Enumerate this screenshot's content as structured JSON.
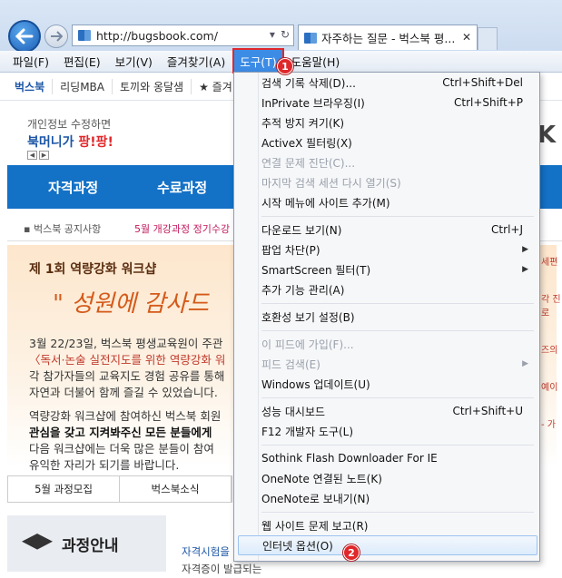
{
  "browser": {
    "url": "http://bugsbook.com/",
    "tab_title": "자주하는 질문 - 벅스북 평..."
  },
  "menubar": {
    "items": [
      {
        "label": "파일(F)"
      },
      {
        "label": "편집(E)"
      },
      {
        "label": "보기(V)"
      },
      {
        "label": "즐겨찾기(A)"
      },
      {
        "label": "도구(T)"
      },
      {
        "label": "도움말(H)"
      }
    ]
  },
  "favorites": {
    "items": [
      {
        "label": "벅스북"
      },
      {
        "label": "리딩MBA"
      },
      {
        "label": "토끼와 옹달샘"
      },
      {
        "label": "★ 즐겨"
      }
    ]
  },
  "page": {
    "promo_text": "개인정보 수정하면",
    "promo_brand_a": "북머니가 ",
    "promo_brand_b": "팡!팡!",
    "logo_letter": "K",
    "nav": [
      "자격과정",
      "수료과정"
    ],
    "notice_label": "벅스북 공지사항",
    "notice_text": "5월 개강과정 정기수강",
    "banner_title": "제 1회 역량강화 워크샵",
    "banner_quote": "\" 성원에 감사드",
    "banner_lines": [
      "3월 22/23일, 벅스북 평생교육원이 주관",
      "〈독서·논술 실전지도를 위한 역량강화 워",
      "각 참가자들의 교육지도 경험 공유를 통해",
      "자연과 더불어 함께 즐길 수 있었습니다.",
      "역량강화 워크샵에 참여하신 벅스북 회원",
      "관심을 갖고 지켜봐주신 모든 분들에게 ",
      "다음 워크샵에는 더욱 많은 분들이 참여",
      "유익한 자리가 되기를 바랍니다."
    ],
    "side_ads": [
      "세편",
      "각 진로",
      "즈의",
      "예이",
      "- 가"
    ],
    "subtabs": [
      "5월 과정모집",
      "벅스북소식"
    ],
    "course_label": "과정안내",
    "course_link": "자격시험을 해",
    "course_sub": "자격증이 발급되는"
  },
  "tools_menu": {
    "items": [
      {
        "label": "검색 기록 삭제(D)...",
        "shortcut": "Ctrl+Shift+Del"
      },
      {
        "label": "InPrivate 브라우징(I)",
        "shortcut": "Ctrl+Shift+P"
      },
      {
        "label": "추적 방지 켜기(K)"
      },
      {
        "label": "ActiveX 필터링(X)"
      },
      {
        "label": "연결 문제 진단(C)...",
        "disabled": true
      },
      {
        "label": "마지막 검색 세션 다시 열기(S)",
        "disabled": true
      },
      {
        "label": "시작 메뉴에 사이트 추가(M)"
      },
      {
        "label": "다운로드 보기(N)",
        "shortcut": "Ctrl+J"
      },
      {
        "label": "팝업 차단(P)",
        "submenu": true
      },
      {
        "label": "SmartScreen 필터(T)",
        "submenu": true
      },
      {
        "label": "추가 기능 관리(A)"
      },
      {
        "label": "호환성 보기 설정(B)"
      },
      {
        "label": "이 피드에 가입(F)...",
        "disabled": true
      },
      {
        "label": "피드 검색(E)",
        "disabled": true,
        "submenu": true
      },
      {
        "label": "Windows 업데이트(U)"
      },
      {
        "label": "성능 대시보드",
        "shortcut": "Ctrl+Shift+U"
      },
      {
        "label": "F12 개발자 도구(L)"
      },
      {
        "label": "Sothink Flash Downloader For IE"
      },
      {
        "label": "OneNote 연결된 노트(K)"
      },
      {
        "label": "OneNote로 보내기(N)"
      },
      {
        "label": "웹 사이트 문제 보고(R)"
      },
      {
        "label": "인터넷 옵션(O)"
      }
    ]
  },
  "annotations": {
    "step1": "1",
    "step2": "2"
  },
  "icons": {
    "back": "back-arrow-icon",
    "forward": "forward-arrow-icon",
    "accent": "#e0272b"
  }
}
